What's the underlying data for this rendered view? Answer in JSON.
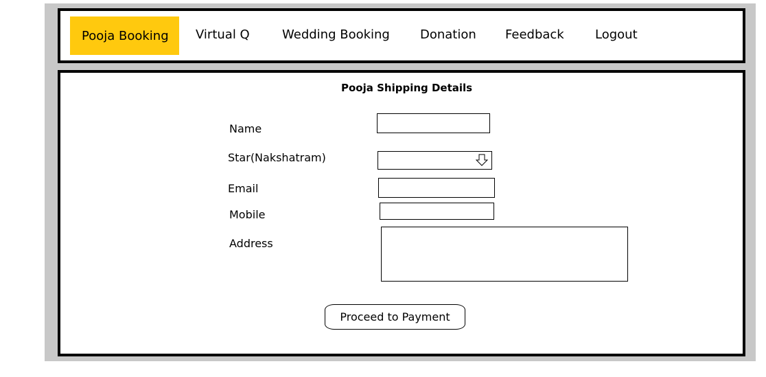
{
  "nav": {
    "items": [
      {
        "label": "Pooja Booking",
        "active": true
      },
      {
        "label": "Virtual Q",
        "active": false
      },
      {
        "label": "Wedding Booking",
        "active": false
      },
      {
        "label": "Donation",
        "active": false
      },
      {
        "label": "Feedback",
        "active": false
      },
      {
        "label": "Logout",
        "active": false
      }
    ],
    "active_color": "#ffc90e"
  },
  "form": {
    "title": "Pooja Shipping Details",
    "name_label": "Name",
    "name_value": "",
    "star_label": "Star(Nakshatram)",
    "star_value": "",
    "star_icon": "down-arrow-icon",
    "email_label": "Email",
    "email_value": "",
    "mobile_label": "Mobile",
    "mobile_value": "",
    "address_label": "Address",
    "address_value": "",
    "submit_label": "Proceed to Payment"
  },
  "colors": {
    "frame": "#c8c8c8",
    "border": "#000000"
  }
}
